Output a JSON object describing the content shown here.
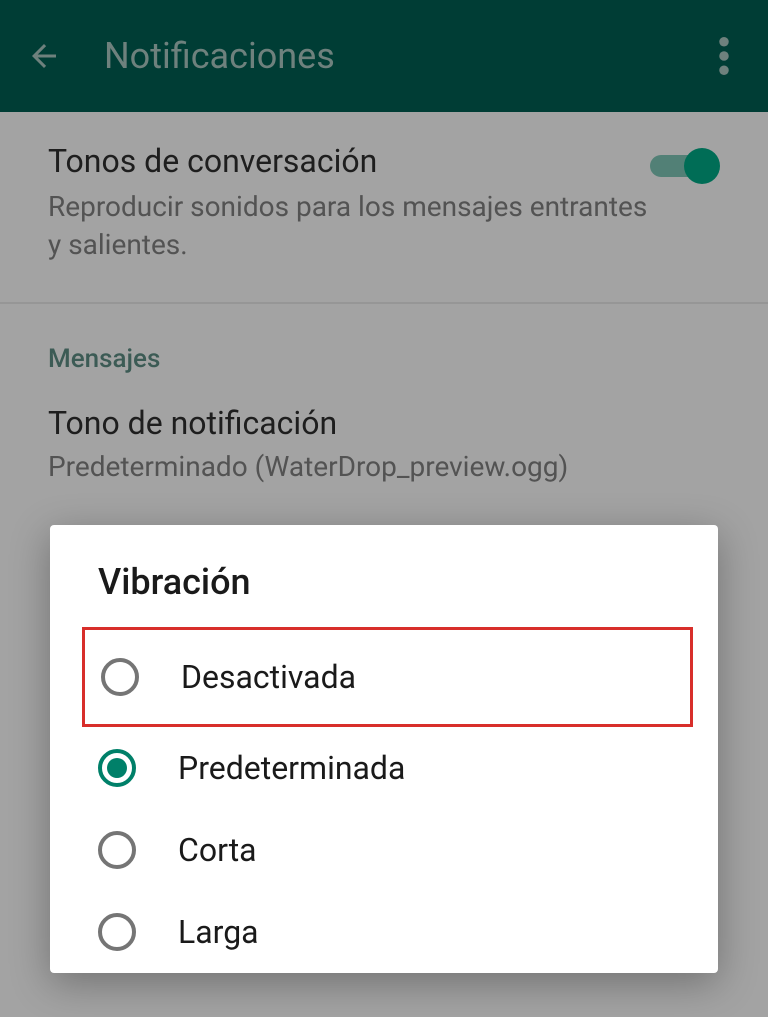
{
  "header": {
    "title": "Notificaciones"
  },
  "settings": {
    "conversationTones": {
      "title": "Tonos de conversación",
      "subtitle": "Reproducir sonidos para los mensajes entrantes y salientes.",
      "enabled": true
    },
    "messagesSection": "Mensajes",
    "notificationTone": {
      "title": "Tono de notificación",
      "value": "Predeterminado (WaterDrop_preview.ogg)"
    }
  },
  "dialog": {
    "title": "Vibración",
    "options": [
      {
        "label": "Desactivada",
        "selected": false,
        "highlighted": true
      },
      {
        "label": "Predeterminada",
        "selected": true,
        "highlighted": false
      },
      {
        "label": "Corta",
        "selected": false,
        "highlighted": false
      },
      {
        "label": "Larga",
        "selected": false,
        "highlighted": false
      }
    ]
  },
  "colors": {
    "headerBg": "#005e52",
    "accent": "#008069",
    "highlight": "#d82e2a"
  }
}
